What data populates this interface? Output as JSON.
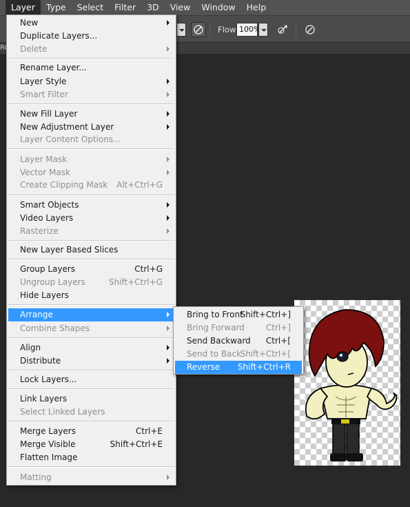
{
  "colors": {
    "menubar_bg": "#535353",
    "workspace_bg": "#282828",
    "menu_bg": "#f0f0f0",
    "highlight": "#3399ff",
    "disabled_text": "#8e8e8e"
  },
  "menubar": {
    "items": [
      "Layer",
      "Type",
      "Select",
      "Filter",
      "3D",
      "View",
      "Window",
      "Help"
    ],
    "active": "Layer"
  },
  "options_bar": {
    "flow_label": "Flow:",
    "flow_value": "100%",
    "icons": [
      "airbrush-pressure-icon",
      "airbrush-icon",
      "tablet-pressure-size-icon"
    ]
  },
  "doc_tab": {
    "partial_text": "RC"
  },
  "layer_menu": {
    "items": [
      {
        "label": "New",
        "shortcut": "",
        "submenu": true,
        "disabled": false
      },
      {
        "label": "Duplicate Layers...",
        "shortcut": "",
        "submenu": false,
        "disabled": false
      },
      {
        "label": "Delete",
        "shortcut": "",
        "submenu": true,
        "disabled": true
      },
      {
        "label": "Rename Layer...",
        "shortcut": "",
        "submenu": false,
        "disabled": false
      },
      {
        "label": "Layer Style",
        "shortcut": "",
        "submenu": true,
        "disabled": false
      },
      {
        "label": "Smart Filter",
        "shortcut": "",
        "submenu": true,
        "disabled": true
      },
      {
        "label": "New Fill Layer",
        "shortcut": "",
        "submenu": true,
        "disabled": false
      },
      {
        "label": "New Adjustment Layer",
        "shortcut": "",
        "submenu": true,
        "disabled": false
      },
      {
        "label": "Layer Content Options...",
        "shortcut": "",
        "submenu": false,
        "disabled": true
      },
      {
        "label": "Layer Mask",
        "shortcut": "",
        "submenu": true,
        "disabled": true
      },
      {
        "label": "Vector Mask",
        "shortcut": "",
        "submenu": true,
        "disabled": true
      },
      {
        "label": "Create Clipping Mask",
        "shortcut": "Alt+Ctrl+G",
        "submenu": false,
        "disabled": true
      },
      {
        "label": "Smart Objects",
        "shortcut": "",
        "submenu": true,
        "disabled": false
      },
      {
        "label": "Video Layers",
        "shortcut": "",
        "submenu": true,
        "disabled": false
      },
      {
        "label": "Rasterize",
        "shortcut": "",
        "submenu": true,
        "disabled": true
      },
      {
        "label": "New Layer Based Slices",
        "shortcut": "",
        "submenu": false,
        "disabled": false
      },
      {
        "label": "Group Layers",
        "shortcut": "Ctrl+G",
        "submenu": false,
        "disabled": false
      },
      {
        "label": "Ungroup Layers",
        "shortcut": "Shift+Ctrl+G",
        "submenu": false,
        "disabled": true
      },
      {
        "label": "Hide Layers",
        "shortcut": "",
        "submenu": false,
        "disabled": false
      },
      {
        "label": "Arrange",
        "shortcut": "",
        "submenu": true,
        "disabled": false,
        "highlighted": true
      },
      {
        "label": "Combine Shapes",
        "shortcut": "",
        "submenu": true,
        "disabled": true
      },
      {
        "label": "Align",
        "shortcut": "",
        "submenu": true,
        "disabled": false
      },
      {
        "label": "Distribute",
        "shortcut": "",
        "submenu": true,
        "disabled": false
      },
      {
        "label": "Lock Layers...",
        "shortcut": "",
        "submenu": false,
        "disabled": false
      },
      {
        "label": "Link Layers",
        "shortcut": "",
        "submenu": false,
        "disabled": false
      },
      {
        "label": "Select Linked Layers",
        "shortcut": "",
        "submenu": false,
        "disabled": true
      },
      {
        "label": "Merge Layers",
        "shortcut": "Ctrl+E",
        "submenu": false,
        "disabled": false
      },
      {
        "label": "Merge Visible",
        "shortcut": "Shift+Ctrl+E",
        "submenu": false,
        "disabled": false
      },
      {
        "label": "Flatten Image",
        "shortcut": "",
        "submenu": false,
        "disabled": false
      },
      {
        "label": "Matting",
        "shortcut": "",
        "submenu": true,
        "disabled": true
      }
    ]
  },
  "arrange_submenu": {
    "items": [
      {
        "label": "Bring to Front",
        "shortcut": "Shift+Ctrl+]",
        "disabled": false
      },
      {
        "label": "Bring Forward",
        "shortcut": "Ctrl+]",
        "disabled": true
      },
      {
        "label": "Send Backward",
        "shortcut": "Ctrl+[",
        "disabled": false
      },
      {
        "label": "Send to Back",
        "shortcut": "Shift+Ctrl+[",
        "disabled": true
      },
      {
        "label": "Reverse",
        "shortcut": "Shift+Ctrl+R",
        "disabled": false,
        "highlighted": true
      }
    ]
  }
}
